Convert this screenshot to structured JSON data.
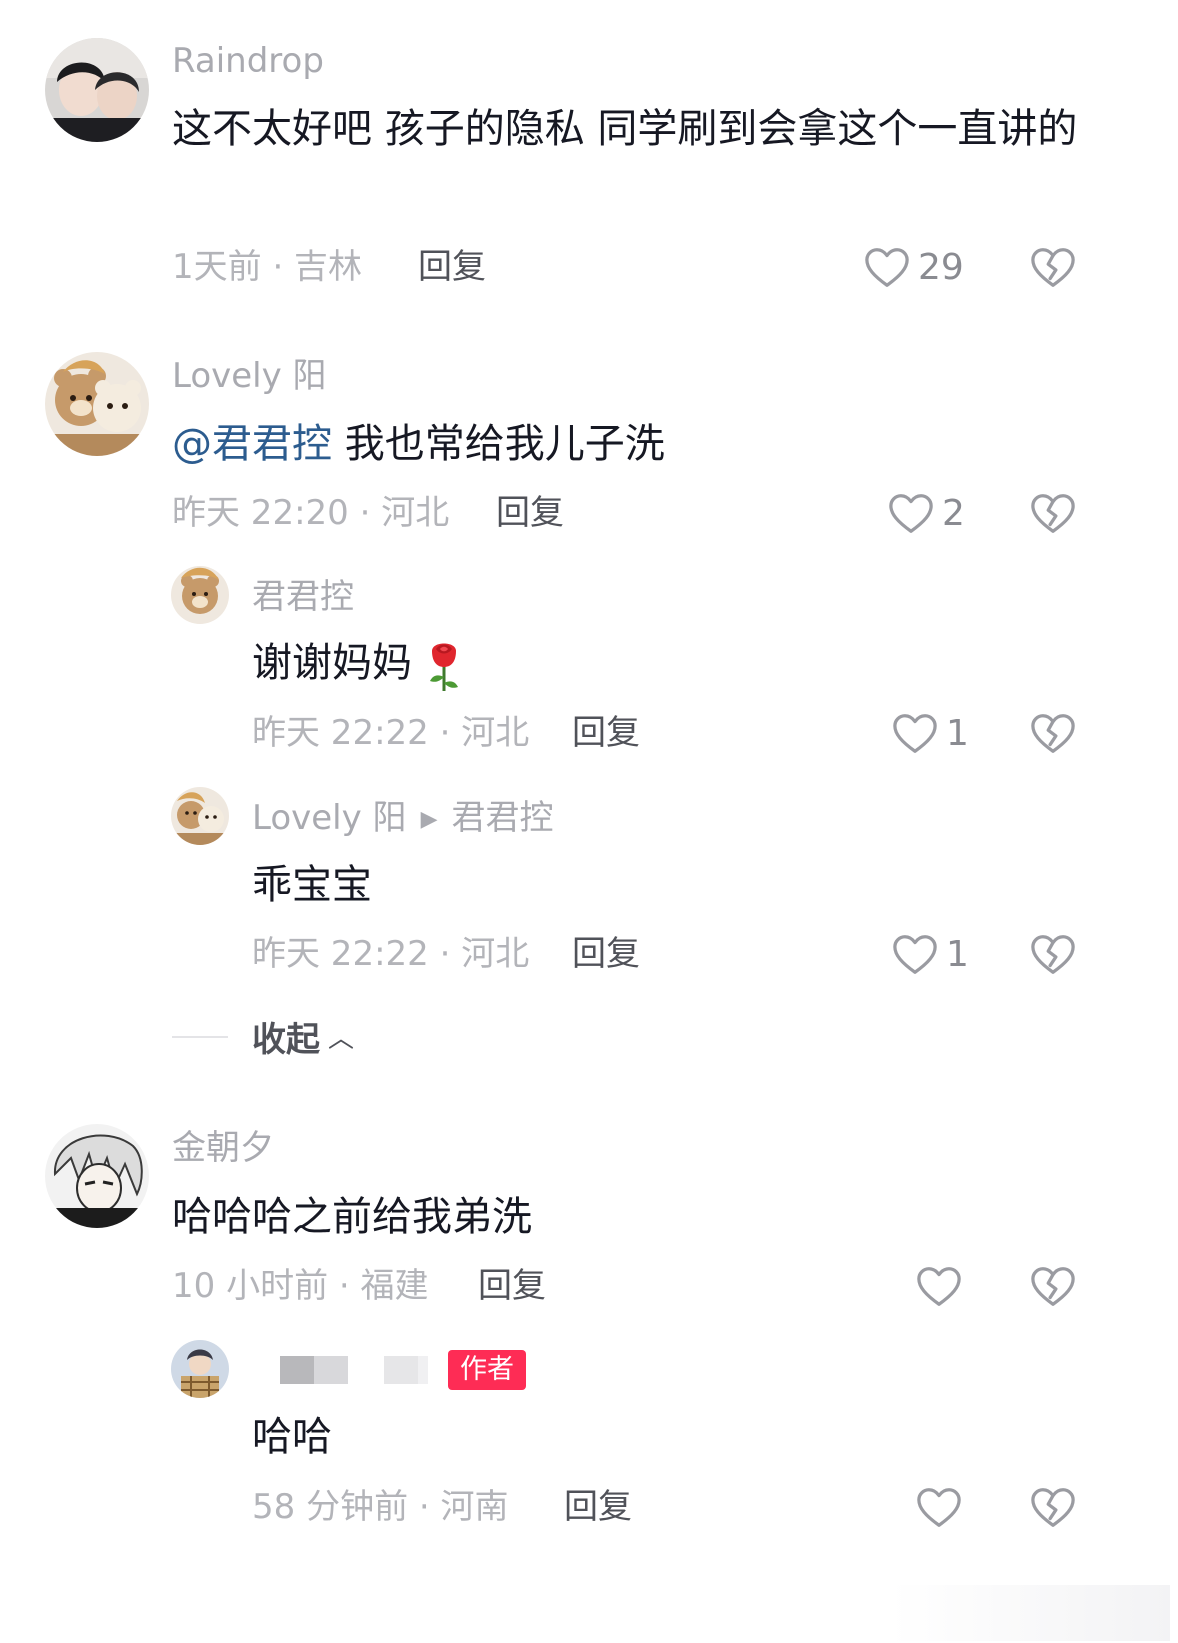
{
  "comments": [
    {
      "username": "Raindrop",
      "text": "这不太好吧 孩子的隐私 同学刷到会拿这个一直讲的",
      "meta": "1天前 · 吉林",
      "reply_label": "回复",
      "likes": "29"
    },
    {
      "username": "Lovely 阳",
      "mention": "@君君控",
      "text": " 我也常给我儿子洗",
      "meta": "昨天 22:20 · 河北",
      "reply_label": "回复",
      "likes": "2",
      "replies": [
        {
          "username": "君君控",
          "text": "谢谢妈妈",
          "emoji": "rose-icon",
          "meta": "昨天 22:22 · 河北",
          "reply_label": "回复",
          "likes": "1"
        },
        {
          "username": "Lovely 阳",
          "reply_to": "君君控",
          "text": "乖宝宝",
          "meta": "昨天 22:22 · 河北",
          "reply_label": "回复",
          "likes": "1"
        }
      ],
      "collapse_label": "收起"
    },
    {
      "username": "金朝夕",
      "text": "哈哈哈之前给我弟洗",
      "meta": "10 小时前 · 福建",
      "reply_label": "回复",
      "likes": "",
      "replies": [
        {
          "author_badge": "作者",
          "text": "哈哈",
          "meta": "58 分钟前 · 河南",
          "reply_label": "回复",
          "likes": ""
        }
      ]
    }
  ],
  "icons": {
    "like": "heart-outline-icon",
    "dislike": "broken-heart-icon",
    "collapse": "chevron-up-icon",
    "reply_arrow": "triangle-right-icon"
  },
  "colors": {
    "mention": "#2c5c8f",
    "author_badge": "#fe2c55",
    "meta": "#b3b4b9",
    "username": "#a9aab0"
  }
}
